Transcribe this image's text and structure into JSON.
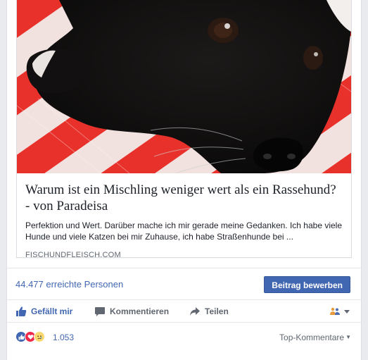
{
  "link_preview": {
    "headline": "Warum ist ein Mischling weniger wert als ein Rassehund? - von Paradeisa",
    "description": "Perfektion und Wert. Darüber mache ich mir gerade meine Gedanken. Ich habe viele Hunde und viele Katzen bei mir Zuhause, ich habe Straßenhunde bei ...",
    "domain": "FISCHUNDFLEISCH.COM",
    "image_icon": "black-puppy-photo"
  },
  "reach": {
    "text": "44.477 erreichte Personen",
    "boost_label": "Beitrag bewerben"
  },
  "actions": {
    "like_label": "Gefällt mir",
    "comment_label": "Kommentieren",
    "share_label": "Teilen",
    "like_icon": "thumbs-up-icon",
    "comment_icon": "speech-bubble-icon",
    "share_icon": "share-arrow-icon",
    "audience_icon": "friends-icon"
  },
  "reactions": {
    "icons": [
      "like-icon",
      "love-icon",
      "sad-icon"
    ],
    "count": "1.053",
    "sort_label": "Top-Kommentare"
  },
  "colors": {
    "brand_blue": "#4267b2",
    "love_red": "#f0284a",
    "sad_yellow": "#fbd971"
  }
}
